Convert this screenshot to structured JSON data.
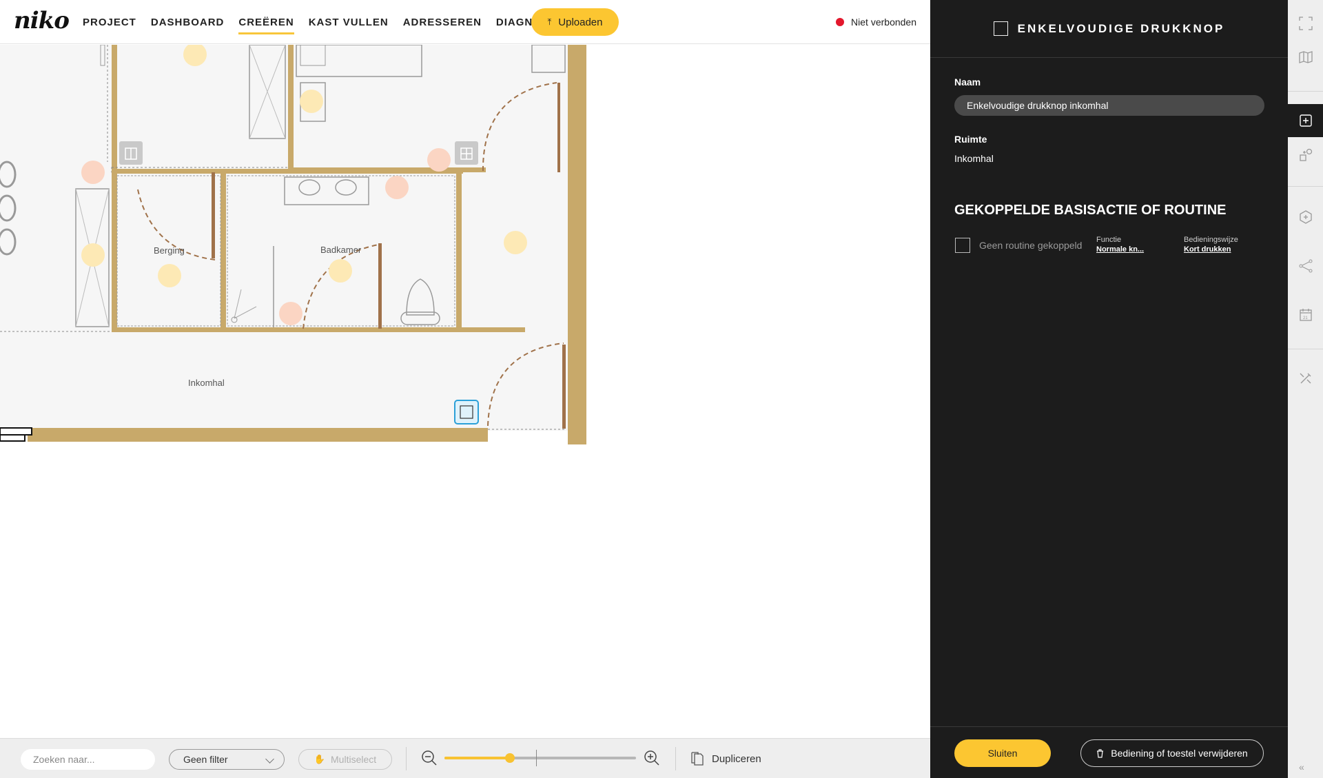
{
  "app": {
    "logo": "niko",
    "upload_label": "Uploaden",
    "connection_status": "Niet verbonden",
    "status_color": "#e3172c",
    "accent_color": "#fcc631"
  },
  "nav": {
    "items": [
      {
        "label": "PROJECT"
      },
      {
        "label": "DASHBOARD"
      },
      {
        "label": "CREËREN",
        "active": true
      },
      {
        "label": "KAST VULLEN"
      },
      {
        "label": "ADRESSEREN"
      },
      {
        "label": "DIAGNOSE",
        "external": true
      }
    ]
  },
  "floorplan": {
    "rooms": [
      {
        "name": "Berging"
      },
      {
        "name": "Badkamer"
      },
      {
        "name": "Inkomhal"
      }
    ]
  },
  "toolbar": {
    "search_placeholder": "Zoeken naar...",
    "filter_value": "Geen filter",
    "multiselect_label": "Multiselect",
    "zoom_level": 0.34,
    "duplicate_label": "Dupliceren"
  },
  "panel": {
    "title": "ENKELVOUDIGE DRUKKNOP",
    "name_label": "Naam",
    "name_value": "Enkelvoudige drukknop inkomhal",
    "room_label": "Ruimte",
    "room_value": "Inkomhal",
    "section_title": "GEKOPPELDE BASISACTIE OF ROUTINE",
    "routine_text": "Geen routine gekoppeld",
    "function_label": "Functie",
    "function_value": "Normale kn...",
    "mode_label": "Bedieningswijze",
    "mode_value": "Kort drukken",
    "close_label": "Sluiten",
    "delete_label": "Bediening of toestel verwijderen"
  },
  "rail": {
    "icons": [
      "fullscreen-icon",
      "map-icon",
      "add-device-icon",
      "shapes-icon",
      "hexagon-add-icon",
      "connections-icon",
      "calendar-icon",
      "tools-icon"
    ]
  }
}
